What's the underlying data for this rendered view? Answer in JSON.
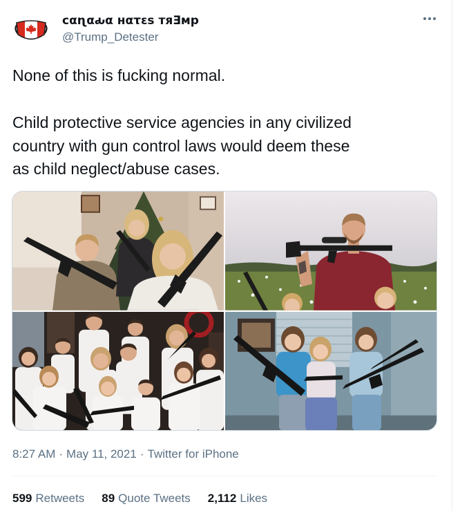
{
  "colors": {
    "text_primary": "#0f1419",
    "text_secondary": "#5b7083",
    "divider": "#eff3f4",
    "border": "#cfd9de"
  },
  "tweet": {
    "author": {
      "display_name": "сαɳαԃα нατεѕ тяƎмр",
      "handle": "@Trump_Detester",
      "avatar_icon": "canada-flag-mask-icon"
    },
    "more_icon": "more-options-icon",
    "text": {
      "paragraph_1": "None of this is fucking normal.",
      "paragraph_2_lines": [
        "Child protective service agencies in any civilized",
        "country with gun control laws would deem these",
        "as child neglect/abuse cases."
      ]
    },
    "meta": {
      "time": "8:27 AM",
      "separator": "·",
      "date": "May 11, 2021",
      "source": "Twitter for iPhone"
    },
    "stats": [
      {
        "count": "599",
        "label": "Retweets"
      },
      {
        "count": "89",
        "label": "Quote Tweets"
      },
      {
        "count": "2,112",
        "label": "Likes"
      }
    ]
  }
}
